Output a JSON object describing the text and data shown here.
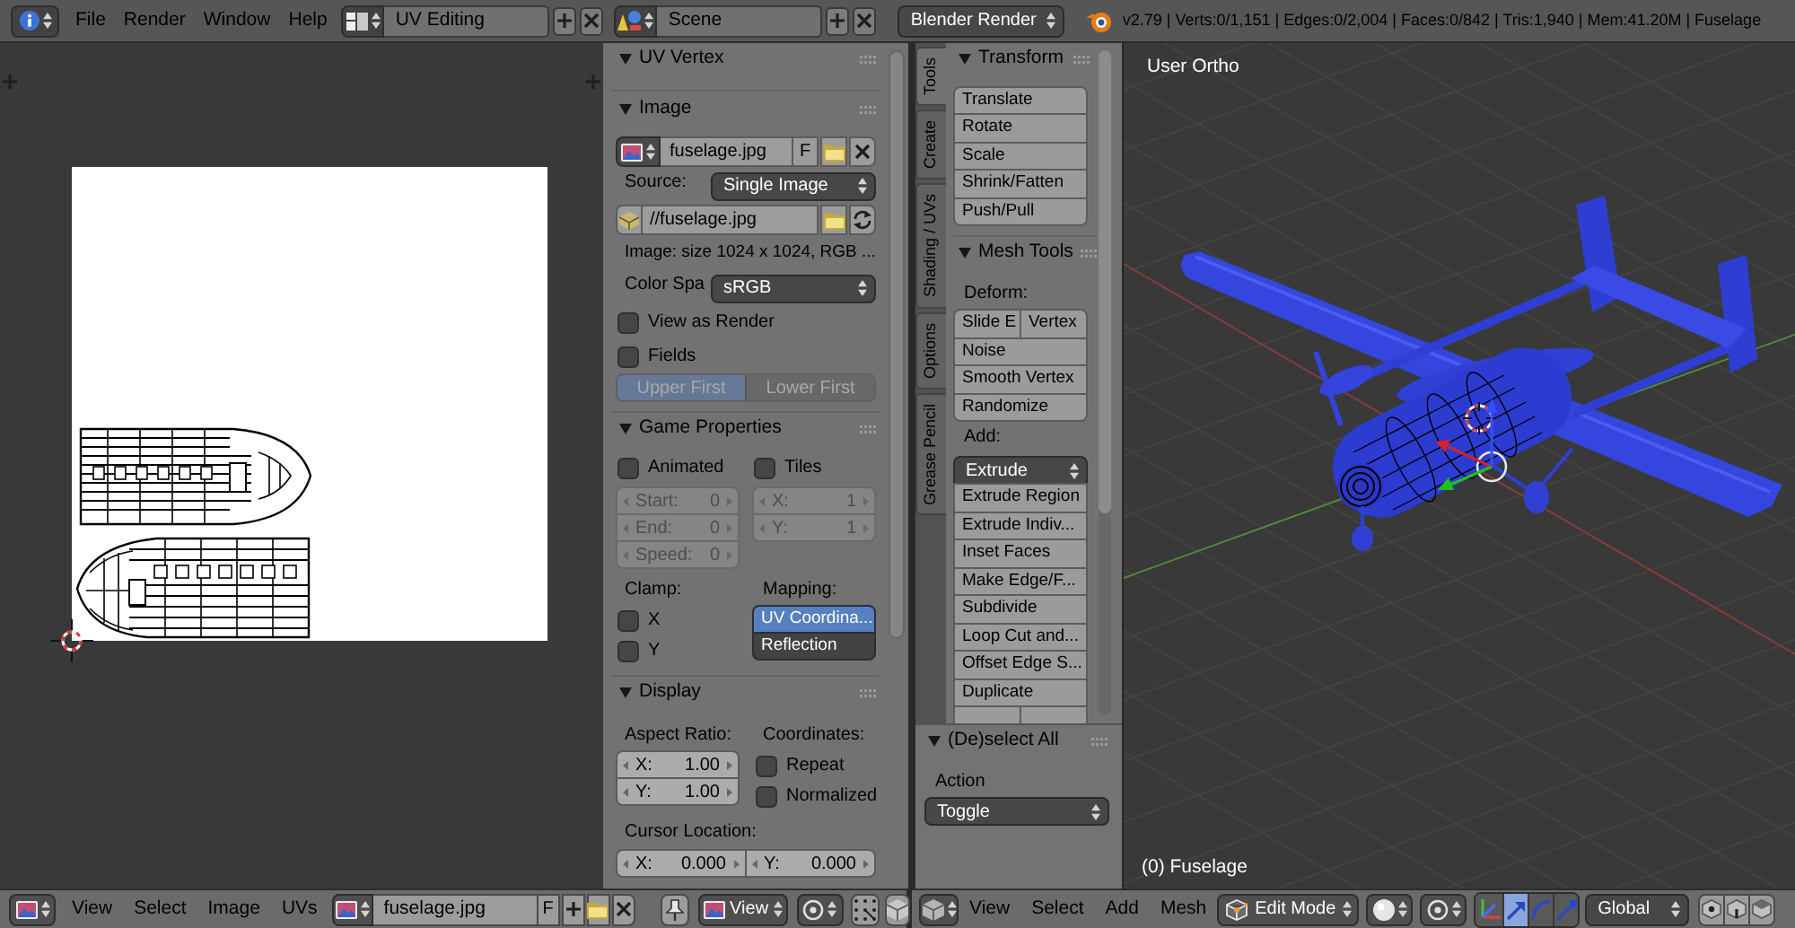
{
  "top_bar": {
    "menus": [
      "File",
      "Render",
      "Window",
      "Help"
    ],
    "screen_layout": "UV Editing",
    "scene": "Scene",
    "render_engine": "Blender Render",
    "stats": "v2.79 | Verts:0/1,151 | Edges:0/2,004 | Faces:0/842 | Tris:1,940 | Mem:41.20M | Fuselage"
  },
  "uv_vertex_panel": {
    "title": "UV Vertex",
    "expanded": true
  },
  "image_panel": {
    "title": "Image",
    "expanded": true,
    "image_name": "fuselage.jpg",
    "fake_user": "F",
    "source_label": "Source:",
    "source": "Single Image",
    "filepath": "//fuselage.jpg",
    "info": "Image: size 1024 x 1024, RGB ...",
    "color_space_label": "Color Spa",
    "color_space": "sRGB",
    "options": [
      {
        "label": "View as Render",
        "checked": false
      },
      {
        "label": "Fields",
        "checked": false
      }
    ],
    "field_order": {
      "disabled": true,
      "options": [
        {
          "label": "Upper First",
          "selected": true
        },
        {
          "label": "Lower First",
          "selected": false
        }
      ]
    }
  },
  "game_properties_panel": {
    "title": "Game Properties",
    "expanded": true,
    "animated": {
      "label": "Animated",
      "checked": false
    },
    "tiles": {
      "label": "Tiles",
      "checked": false
    },
    "animation_fields": [
      {
        "label": "Start:",
        "value": "0",
        "disabled": true
      },
      {
        "label": "End:",
        "value": "0",
        "disabled": true
      },
      {
        "label": "Speed:",
        "value": "0",
        "disabled": true
      }
    ],
    "tile_fields": [
      {
        "label": "X:",
        "value": "1",
        "disabled": true
      },
      {
        "label": "Y:",
        "value": "1",
        "disabled": true
      }
    ],
    "clamp_label": "Clamp:",
    "clamp": [
      {
        "label": "X",
        "checked": false
      },
      {
        "label": "Y",
        "checked": false
      }
    ],
    "mapping_label": "Mapping:",
    "mapping": [
      {
        "label": "UV Coordina...",
        "selected": true
      },
      {
        "label": "Reflection",
        "selected": false
      }
    ]
  },
  "display_panel": {
    "title": "Display",
    "expanded": true,
    "aspect_label": "Aspect Ratio:",
    "aspect": [
      {
        "label": "X:",
        "value": "1.00"
      },
      {
        "label": "Y:",
        "value": "1.00"
      }
    ],
    "coordinates_label": "Coordinates:",
    "coordinates": [
      {
        "label": "Repeat",
        "checked": false
      },
      {
        "label": "Normalized",
        "checked": false
      }
    ],
    "cursor_label": "Cursor Location:",
    "cursor": [
      {
        "label": "X:",
        "value": "0.000"
      },
      {
        "label": "Y:",
        "value": "0.000"
      }
    ]
  },
  "tool_shelf": {
    "tabs": [
      {
        "label": "Tools",
        "selected": true
      },
      {
        "label": "Create",
        "selected": false
      },
      {
        "label": "Shading / UVs",
        "selected": false
      },
      {
        "label": "Options",
        "selected": false
      },
      {
        "label": "Grease Pencil",
        "selected": false
      }
    ],
    "transform_panel": {
      "title": "Transform",
      "expanded": true,
      "buttons": [
        "Translate",
        "Rotate",
        "Scale",
        "Shrink/Fatten",
        "Push/Pull"
      ]
    },
    "mesh_tools_panel": {
      "title": "Mesh Tools",
      "expanded": true,
      "deform_label": "Deform:",
      "slide_buttons": [
        "Slide E",
        "Vertex"
      ],
      "deform_buttons": [
        "Noise",
        "Smooth Vertex",
        "Randomize"
      ],
      "add_label": "Add:",
      "extrude": "Extrude",
      "add_buttons": [
        "Extrude Region",
        "Extrude Indiv...",
        "Inset Faces",
        "Make Edge/F...",
        "Subdivide",
        "Loop Cut and...",
        "Offset Edge S...",
        "Duplicate"
      ]
    }
  },
  "operator_panel": {
    "title": "(De)select All",
    "expanded": true,
    "action_label": "Action",
    "action": "Toggle"
  },
  "viewport": {
    "view_name": "User Ortho",
    "object_name": "(0) Fuselage"
  },
  "uv_editor_header": {
    "menus": [
      "View",
      "Select",
      "Image",
      "UVs"
    ],
    "image_name": "fuselage.jpg",
    "fake_user": "F",
    "view_mode": "View"
  },
  "view3d_header": {
    "menus": [
      "View",
      "Select",
      "Add",
      "Mesh"
    ],
    "mode": "Edit Mode",
    "manipulators": [
      {
        "kind": "translate",
        "selected": true
      },
      {
        "kind": "rotate",
        "selected": false
      },
      {
        "kind": "scale",
        "selected": false
      }
    ],
    "orientation": "Global"
  }
}
